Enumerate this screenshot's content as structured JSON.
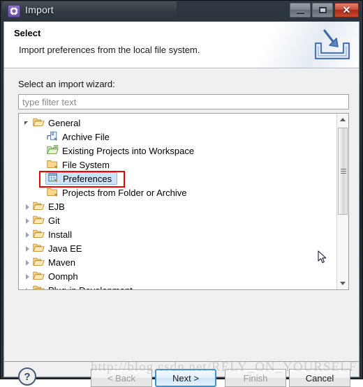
{
  "window": {
    "title": "Import",
    "icon": "gear-icon",
    "controls": {
      "minimize": "minimize-icon",
      "maximize": "maximize-icon",
      "close": "✕"
    }
  },
  "header": {
    "title": "Select",
    "description": "Import preferences from the local file system.",
    "icon": "import-tray-icon"
  },
  "body": {
    "wizard_label": "Select an import wizard:",
    "filter": {
      "value": "",
      "placeholder": "type filter text"
    },
    "tree": [
      {
        "label": "General",
        "depth": 0,
        "state": "expanded",
        "icon": "folder-open-icon",
        "selected": false
      },
      {
        "label": "Archive File",
        "depth": 1,
        "state": "leaf",
        "icon": "archive-file-icon",
        "selected": false
      },
      {
        "label": "Existing Projects into Workspace",
        "depth": 1,
        "state": "leaf",
        "icon": "projects-import-icon",
        "selected": false
      },
      {
        "label": "File System",
        "depth": 1,
        "state": "leaf",
        "icon": "folder-icon",
        "selected": false
      },
      {
        "label": "Preferences",
        "depth": 1,
        "state": "leaf",
        "icon": "preferences-icon",
        "selected": true
      },
      {
        "label": "Projects from Folder or Archive",
        "depth": 1,
        "state": "leaf",
        "icon": "folder-icon",
        "selected": false
      },
      {
        "label": "EJB",
        "depth": 0,
        "state": "collapsed",
        "icon": "folder-open-icon",
        "selected": false
      },
      {
        "label": "Git",
        "depth": 0,
        "state": "collapsed",
        "icon": "folder-open-icon",
        "selected": false
      },
      {
        "label": "Install",
        "depth": 0,
        "state": "collapsed",
        "icon": "folder-open-icon",
        "selected": false
      },
      {
        "label": "Java EE",
        "depth": 0,
        "state": "collapsed",
        "icon": "folder-open-icon",
        "selected": false
      },
      {
        "label": "Maven",
        "depth": 0,
        "state": "collapsed",
        "icon": "folder-open-icon",
        "selected": false
      },
      {
        "label": "Oomph",
        "depth": 0,
        "state": "collapsed",
        "icon": "folder-open-icon",
        "selected": false
      },
      {
        "label": "Plug-in Development",
        "depth": 0,
        "state": "collapsed",
        "icon": "folder-open-icon",
        "selected": false
      }
    ],
    "annotation": {
      "target": "Preferences",
      "color": "#ee0000"
    },
    "scrollbar": {
      "up_icon": "scroll-up-arrow-icon",
      "down_icon": "scroll-down-arrow-icon",
      "thumb_icon": "scroll-thumb-grip"
    }
  },
  "footer": {
    "help": "?",
    "back": "< Back",
    "next": "Next >",
    "finish": "Finish",
    "cancel": "Cancel"
  },
  "watermark": "http://blog.csdn.net/RELY_ON_YOURSELF",
  "colors": {
    "titlebar": "#2b333c",
    "dialog_bg": "#f0f0f0",
    "selection": "#cde3f7",
    "annotation": "#ee0000",
    "default_button_border": "#3c93d6"
  }
}
